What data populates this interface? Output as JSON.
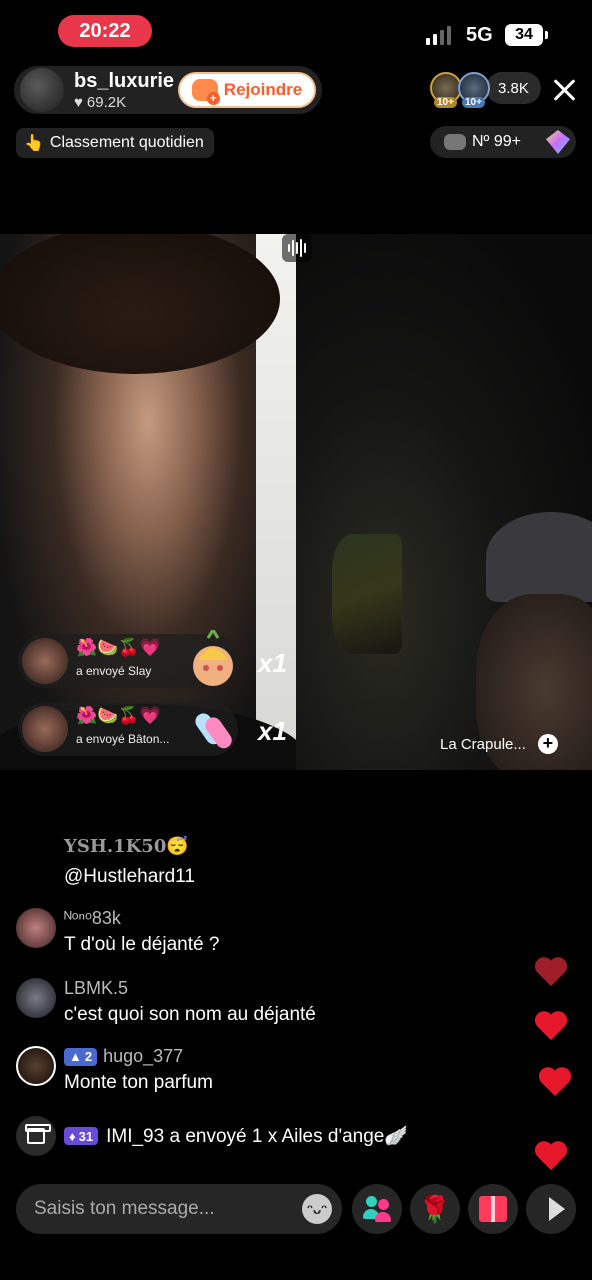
{
  "status_bar": {
    "time": "20:22",
    "network": "5G",
    "battery": "34"
  },
  "host": {
    "name": "bs_luxurie",
    "likes": "69.2K",
    "join_label": "Rejoindre"
  },
  "viewers": {
    "badge_1": "10+",
    "badge_2": "10+",
    "count": "3.8K"
  },
  "ranking": {
    "label": "Classement quotidien",
    "icon": "👆",
    "position": "Nº 99+"
  },
  "gifts": [
    {
      "emojis": "🌺🍉🍒💗",
      "text": "a envoyé  Slay",
      "multiplier": "x1",
      "icon": "slay-sticker"
    },
    {
      "emojis": "🌺🍉🍒💗",
      "text": "a envoyé  Bâton...",
      "multiplier": "x1",
      "icon": "baton-sticker"
    }
  ],
  "opponent": {
    "name": "La Crapule..."
  },
  "comments": {
    "first_name": "YSH.1K50😴",
    "first_text": "@Hustlehard11",
    "items": [
      {
        "name": "ᴺᵒⁿᵒ83k",
        "text": "T d'où le déjanté ?",
        "badge": ""
      },
      {
        "name": "LBMK.5",
        "text": "c'est quoi son nom au déjanté",
        "badge": ""
      },
      {
        "name": "hugo_377",
        "text": "Monte ton parfum",
        "badge": "2"
      }
    ],
    "gift_event": {
      "badge": "31",
      "text": "IMI_93 a envoyé 1 x Ailes d'ange🪽"
    }
  },
  "bottom_bar": {
    "placeholder": "Saisis ton message...",
    "rose_icon": "🌹"
  },
  "colors": {
    "accent": "#fe5a2a",
    "time_pill": "#e8364a",
    "heart": "#e8182c"
  }
}
